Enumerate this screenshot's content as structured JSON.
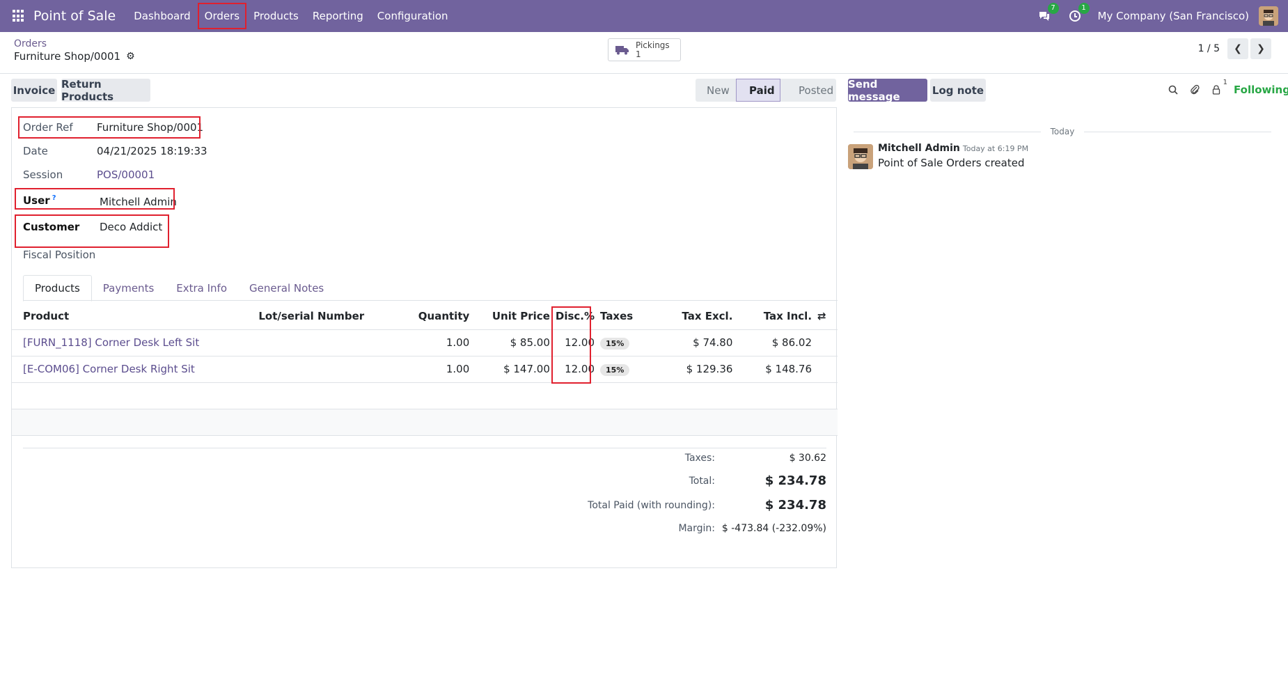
{
  "navbar": {
    "brand": "Point of Sale",
    "menu": [
      "Dashboard",
      "Orders",
      "Products",
      "Reporting",
      "Configuration"
    ],
    "messages_count": "7",
    "activities_count": "1",
    "company": "My Company (San Francisco)"
  },
  "breadcrumb": {
    "parent": "Orders",
    "current": "Furniture Shop/0001"
  },
  "smart_button": {
    "label": "Pickings",
    "count": "1"
  },
  "pager": {
    "value": "1 / 5"
  },
  "actions": {
    "invoice": "Invoice",
    "return_products": "Return Products"
  },
  "status": {
    "stages": [
      "New",
      "Paid",
      "Posted"
    ],
    "current": "Paid"
  },
  "form": {
    "order_ref_label": "Order Ref",
    "order_ref": "Furniture Shop/0001",
    "date_label": "Date",
    "date": "04/21/2025 18:19:33",
    "session_label": "Session",
    "session": "POS/00001",
    "user_label": "User",
    "user_help": "?",
    "user": "Mitchell Admin",
    "customer_label": "Customer",
    "customer": "Deco Addict",
    "fiscal_label": "Fiscal Position"
  },
  "tabs": [
    "Products",
    "Payments",
    "Extra Info",
    "General Notes"
  ],
  "lines": {
    "headers": [
      "Product",
      "Lot/serial Number",
      "Quantity",
      "Unit Price",
      "Disc.%",
      "Taxes",
      "Tax Excl.",
      "Tax Incl."
    ],
    "rows": [
      {
        "product": "[FURN_1118] Corner Desk Left Sit",
        "lot": "",
        "qty": "1.00",
        "price": "$ 85.00",
        "disc": "12.00",
        "tax": "15%",
        "excl": "$ 74.80",
        "incl": "$ 86.02"
      },
      {
        "product": "[E-COM06] Corner Desk Right Sit",
        "lot": "",
        "qty": "1.00",
        "price": "$ 147.00",
        "disc": "12.00",
        "tax": "15%",
        "excl": "$ 129.36",
        "incl": "$ 148.76"
      }
    ]
  },
  "totals": {
    "taxes_label": "Taxes:",
    "taxes": "$ 30.62",
    "total_label": "Total:",
    "total": "$ 234.78",
    "paid_label": "Total Paid (with rounding):",
    "paid": "$ 234.78",
    "margin_label": "Margin:",
    "margin": "$ -473.84 (-232.09%)"
  },
  "chatter": {
    "send_message": "Send message",
    "log_note": "Log note",
    "followers_count": "1",
    "following": "Following",
    "date_sep": "Today",
    "message": {
      "author": "Mitchell Admin",
      "date": "Today at 6:19 PM",
      "body": "Point of Sale Orders created"
    }
  },
  "colors": {
    "brand": "#71639e",
    "highlight": "#e0202e",
    "following": "#28a745"
  }
}
